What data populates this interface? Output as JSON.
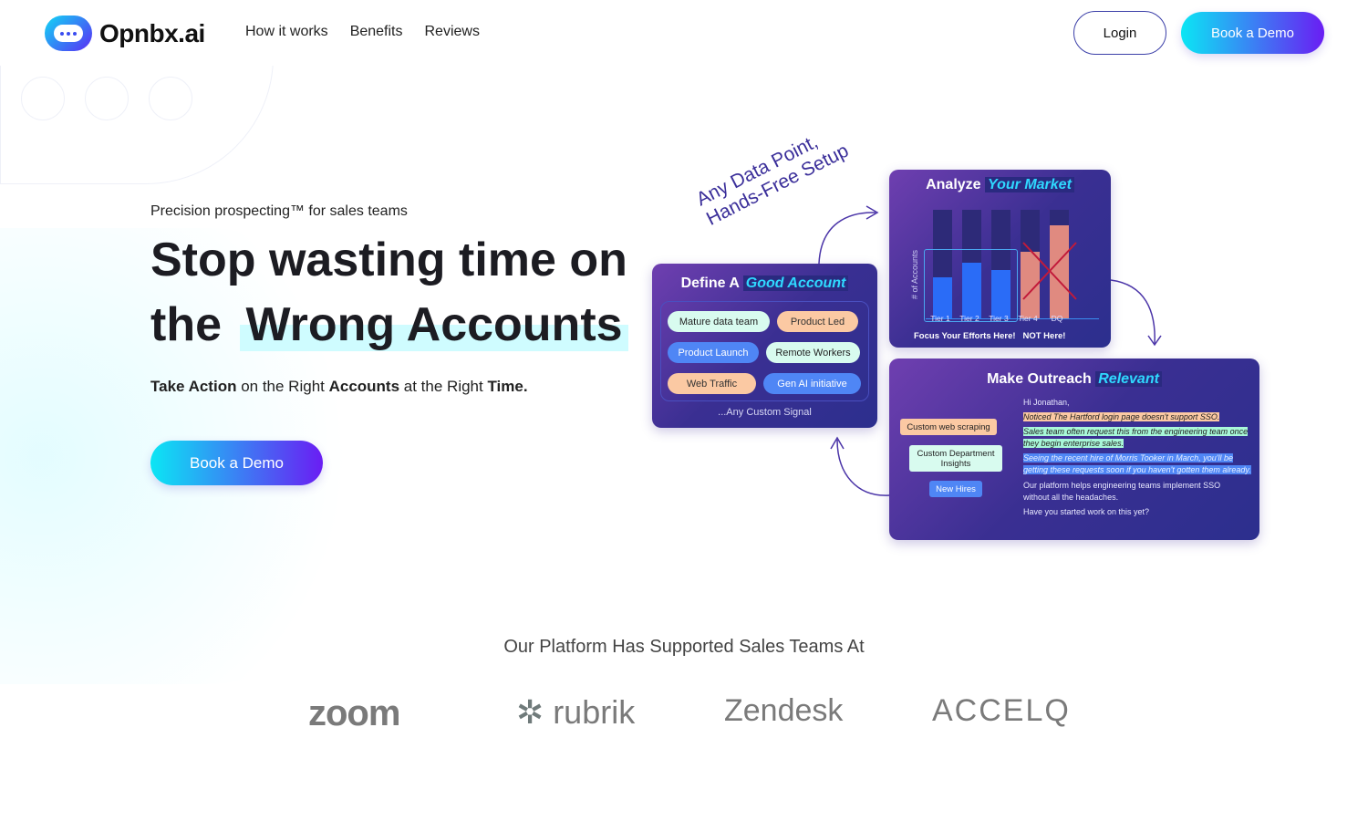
{
  "nav": {
    "brand": "Opnbx.ai",
    "links": [
      "How it works",
      "Benefits",
      "Reviews"
    ],
    "login": "Login",
    "demo": "Book a Demo"
  },
  "hero": {
    "tagline": "Precision prospecting™  for sales teams",
    "title_line1": "Stop wasting time on",
    "title_line2a": "the",
    "title_line2b": "Wrong Accounts",
    "sub": {
      "a": "Take Action",
      "b": " on the Right ",
      "c": "Accounts",
      "d": " at the Right ",
      "e": "Time."
    },
    "cta": "Book a Demo"
  },
  "illustration": {
    "annotation": "Any Data Point,\nHands-Free Setup",
    "define": {
      "title_a": "Define A",
      "title_b": "Good Account",
      "chips": [
        "Mature data team",
        "Product Led",
        "Product Launch",
        "Remote Workers",
        "Web Traffic",
        "Gen AI initiative"
      ],
      "footer": "...Any Custom Signal"
    },
    "analyze": {
      "title_a": "Analyze",
      "title_b": "Your Market",
      "ylabel": "# of Accounts",
      "tiers": [
        "Tier 1",
        "Tier 2",
        "Tier 3",
        "Tier 4",
        "DQ"
      ],
      "bar_levels_pct": [
        38,
        52,
        45,
        62,
        86
      ],
      "focus": "Focus Your Efforts Here!",
      "not": "NOT Here!"
    },
    "outreach": {
      "title_a": "Make Outreach",
      "title_b": "Relevant",
      "labels": [
        "Custom web scraping",
        "Custom Department Insights",
        "New Hires"
      ],
      "greeting": "Hi Jonathan,",
      "line1": "Noticed The Hartford login page doesn't support SSO.",
      "line2": "Sales team often request this from the engineering team once they begin enterprise sales.",
      "line3": "Seeing the recent hire of Morris Tooker in March, you'll be getting these requests soon if you haven't gotten them already.",
      "line4": "Our platform helps engineering teams implement SSO without all the headaches.",
      "line5": "Have you started work on this yet?"
    },
    "colors": {
      "mint": "#d8fbef",
      "peach": "#fbc9a3",
      "blue": "#4f86f5",
      "card": "#3a2f92"
    }
  },
  "trusted": {
    "heading": "Our Platform Has Supported Sales Teams At",
    "logos": [
      "zoom",
      "rubrik",
      "Zendesk",
      "ACCELQ"
    ]
  }
}
